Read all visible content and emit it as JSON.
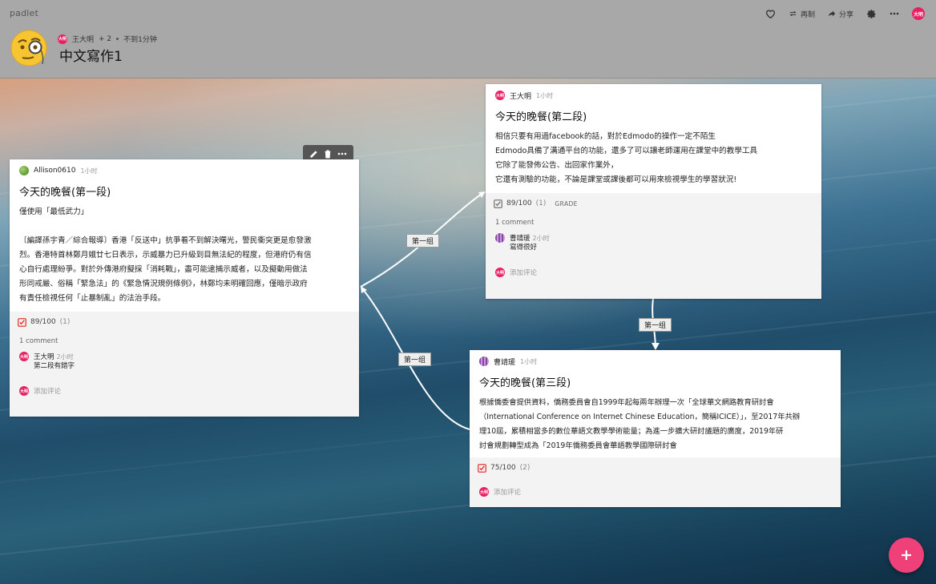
{
  "header": {
    "brand": "padlet",
    "author": "王大明",
    "author_avatar": "大明",
    "contributors": "+ 2",
    "updated": "不到1分钟",
    "title": "中文寫作1",
    "actions": {
      "remake": "再制",
      "share": "分享"
    },
    "user_avatar": "大明"
  },
  "posts": [
    {
      "author": "Allison0610",
      "time": "1小时",
      "title": "今天的晚餐(第一段)",
      "body": [
        "僅使用「最低武力」",
        "",
        "〔編譯孫宇青／綜合報導〕香港「反送中」抗爭看不到解決曙光，警民衝突更是愈發激",
        "烈。香港特首林鄭月娥廿七日表示，示威暴力已升級到目無法紀的程度，但港府仍有信",
        "心自行處理紛爭。對於外傳港府擬採「消耗戰」，盡可能逮捕示威者，以及擬動用做法",
        "形同戒嚴、俗稱「緊急法」的《緊急情況規例條例》，林鄭均未明確回應，僅暗示政府",
        "有責任檢視任何「止暴制亂」的法治手段。"
      ],
      "grade": "89/100",
      "grade_count": "(1)",
      "comments_count": "1 comment",
      "comment": {
        "author": "王大明",
        "avatar": "大明",
        "time": "2小时",
        "text": "第二段有錯字"
      },
      "add_comment": "添加评论",
      "add_avatar": "大明"
    },
    {
      "author": "王大明",
      "avatar": "大明",
      "time": "1小时",
      "title": "今天的晚餐(第二段)",
      "body": [
        "相信只要有用過facebook的話，對於Edmodo的操作一定不陌生",
        "Edmodo具備了溝通平台的功能，還多了可以讓老師運用在課堂中的教學工具",
        "它除了能發佈公告、出回家作業外，",
        "它還有測驗的功能，不論是課堂或課後都可以用來檢視學生的學習狀況!"
      ],
      "grade": "89/100",
      "grade_count": "(1)",
      "grade_tag": "GRADE",
      "comments_count": "1 comment",
      "comment": {
        "author": "曹靖瑗",
        "time": "2小时",
        "text": "寫得很好"
      },
      "add_comment": "添加评论",
      "add_avatar": "大明"
    },
    {
      "author": "曹靖瑗",
      "time": "1小时",
      "title": "今天的晚餐(第三段)",
      "body": [
        "根據僑委會提供資料，僑務委員會自1999年起每兩年辦理一次「全球華文網路教育研討會",
        "（International Conference on Internet Chinese Education，簡稱ICICE）」，至2017年共辦",
        "理10屆，累積相當多的數位華語文教學學術能量；為進一步擴大研討議題的廣度，2019年研",
        "討會規劃轉型成為「2019年僑務委員會華語教學國際研討會"
      ],
      "grade": "75/100",
      "grade_count": "(2)",
      "add_comment": "添加评论",
      "add_avatar": "大明"
    }
  ],
  "connections": [
    "第一组",
    "第一组",
    "第一组"
  ],
  "colors": {
    "accent": "#f0407a",
    "avatar": "#e91e63",
    "check": "#e53935"
  }
}
